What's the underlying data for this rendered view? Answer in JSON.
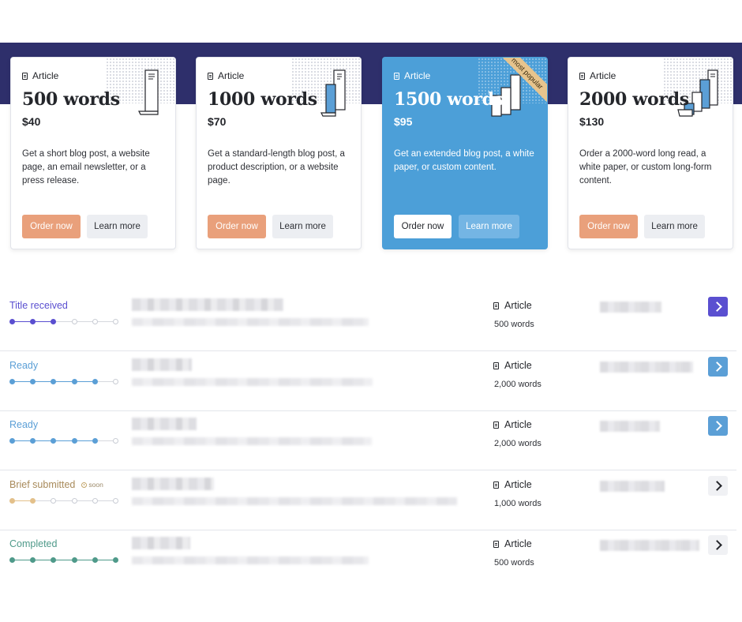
{
  "colors": {
    "navy_band": "#2e2f6b",
    "order_button": "#e9a07b",
    "popular_card": "#4c9fd8",
    "ribbon": "#e7c48d",
    "status_purple": "#5a4fd0",
    "status_blue": "#5b9fd6",
    "status_tan": "#a88a5a",
    "status_green": "#4f9a8a"
  },
  "plans": [
    {
      "kind": "Article",
      "title": "500 words",
      "price": "$40",
      "description": "Get a short blog post, a website page, an email newsletter, or a press release.",
      "order_label": "Order now",
      "learn_label": "Learn more"
    },
    {
      "kind": "Article",
      "title": "1000 words",
      "price": "$70",
      "description": "Get a standard-length blog post, a product description, or a website page.",
      "order_label": "Order now",
      "learn_label": "Learn more"
    },
    {
      "kind": "Article",
      "title": "1500 words",
      "price": "$95",
      "description": "Get an extended blog post, a white paper, or custom content.",
      "order_label": "Order now",
      "learn_label": "Learn more",
      "ribbon": "most popular"
    },
    {
      "kind": "Article",
      "title": "2000 words",
      "price": "$130",
      "description": "Order a 2000-word long read, a white paper, or custom long-form content.",
      "order_label": "Order now",
      "learn_label": "Learn more"
    }
  ],
  "orders": [
    {
      "status": "Title received",
      "steps_done": 3,
      "steps_total": 6,
      "kind": "Article",
      "words": "500 words"
    },
    {
      "status": "Ready",
      "steps_done": 5,
      "steps_total": 6,
      "kind": "Article",
      "words": "2,000 words"
    },
    {
      "status": "Ready",
      "steps_done": 5,
      "steps_total": 6,
      "kind": "Article",
      "words": "2,000 words"
    },
    {
      "status": "Brief submitted",
      "soon_label": "soon",
      "steps_done": 2,
      "steps_total": 6,
      "kind": "Article",
      "words": "1,000 words"
    },
    {
      "status": "Completed",
      "steps_done": 6,
      "steps_total": 6,
      "kind": "Article",
      "words": "500 words"
    }
  ],
  "icons": {
    "kind_icon": "document-icon",
    "go_icon": "chevron-right-icon",
    "soon_icon": "clock-icon"
  }
}
